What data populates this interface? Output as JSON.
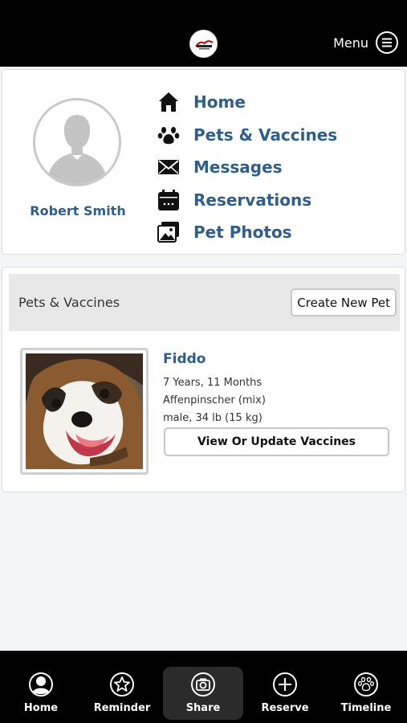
{
  "header": {
    "menu_label": "Menu"
  },
  "profile": {
    "user_name": "Robert Smith"
  },
  "nav": {
    "items": [
      {
        "label": "Home",
        "icon": "home-icon"
      },
      {
        "label": "Pets & Vaccines",
        "icon": "paw-icon"
      },
      {
        "label": "Messages",
        "icon": "envelope-icon"
      },
      {
        "label": "Reservations",
        "icon": "calendar-icon"
      },
      {
        "label": "Pet Photos",
        "icon": "photos-icon"
      }
    ]
  },
  "pets_section": {
    "title": "Pets & Vaccines",
    "create_button": "Create New Pet",
    "pets": [
      {
        "name": "Fiddo",
        "age": "7 Years, 11 Months",
        "breed": "Affenpinscher (mix)",
        "details": "male, 34 lb (15 kg)",
        "vaccine_button": "View Or Update Vaccines"
      }
    ]
  },
  "bottom_nav": {
    "tabs": [
      {
        "label": "Home",
        "icon": "user-circle-icon"
      },
      {
        "label": "Reminder",
        "icon": "star-circle-icon"
      },
      {
        "label": "Share",
        "icon": "camera-icon",
        "active": true
      },
      {
        "label": "Reserve",
        "icon": "plus-circle-icon"
      },
      {
        "label": "Timeline",
        "icon": "paw-circle-icon"
      }
    ]
  },
  "colors": {
    "accent": "#2f5d8c",
    "header_bg": "#000000",
    "page_bg": "#f4f5f6"
  }
}
